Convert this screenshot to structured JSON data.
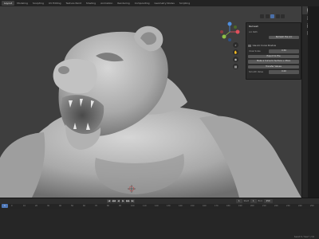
{
  "menu": {
    "tabs": [
      {
        "label": "Layout",
        "active": true
      },
      {
        "label": "Modeling",
        "active": false
      },
      {
        "label": "Sculpting",
        "active": false
      },
      {
        "label": "UV Editing",
        "active": false
      },
      {
        "label": "Texture Paint",
        "active": false
      },
      {
        "label": "Shading",
        "active": false
      },
      {
        "label": "Animation",
        "active": false
      },
      {
        "label": "Rendering",
        "active": false
      },
      {
        "label": "Compositing",
        "active": false
      },
      {
        "label": "Geometry Nodes",
        "active": false
      },
      {
        "label": "Scripting",
        "active": false
      }
    ]
  },
  "viewport": {
    "background_color": "#3e3e3e",
    "model_color": "#b8b8b8",
    "gizmo": {
      "x_color": "#e0505c",
      "y_color": "#8ec046",
      "z_color": "#4f8fe0"
    },
    "nav_icons": [
      "zoom-icon",
      "hand-icon",
      "camera-icon",
      "grid-icon"
    ]
  },
  "npanel": {
    "title": "Remesh",
    "object_label": "Arc Path",
    "object_value": "",
    "button_remesh": "Remesh the Arc",
    "checkbox_label": "Use Arc Curve Shadow",
    "rows": [
      {
        "label": "Voxel Scale",
        "value": "0.50"
      },
      {
        "label": "",
        "value": "Export to File"
      },
      {
        "label": "",
        "value": "Make a Curve to Surface + More"
      },
      {
        "label": "",
        "value": "Transfer Values"
      },
      {
        "label": "Smooth Value",
        "value": "0.00"
      }
    ]
  },
  "sidebar": {
    "tabs": [
      {
        "label": "Item",
        "active": true
      },
      {
        "label": "Tool",
        "active": false
      },
      {
        "label": "View",
        "active": false
      },
      {
        "label": "Edit",
        "active": false
      }
    ]
  },
  "timeline": {
    "playback_controls": [
      "|◀",
      "◀◀",
      "◀",
      "▶",
      "▶▶",
      "▶|"
    ],
    "current_frame": "1",
    "start_label": "Start",
    "start_value": "1",
    "end_label": "End",
    "end_value": "250",
    "ruler_ticks": [
      "0",
      "10",
      "20",
      "30",
      "40",
      "50",
      "60",
      "70",
      "80",
      "90",
      "100",
      "110",
      "120",
      "130",
      "140",
      "150",
      "160",
      "170",
      "180",
      "190",
      "200",
      "210",
      "220",
      "230",
      "240",
      "250"
    ],
    "status_text": "Saved to \"bear\" | 3.6"
  }
}
